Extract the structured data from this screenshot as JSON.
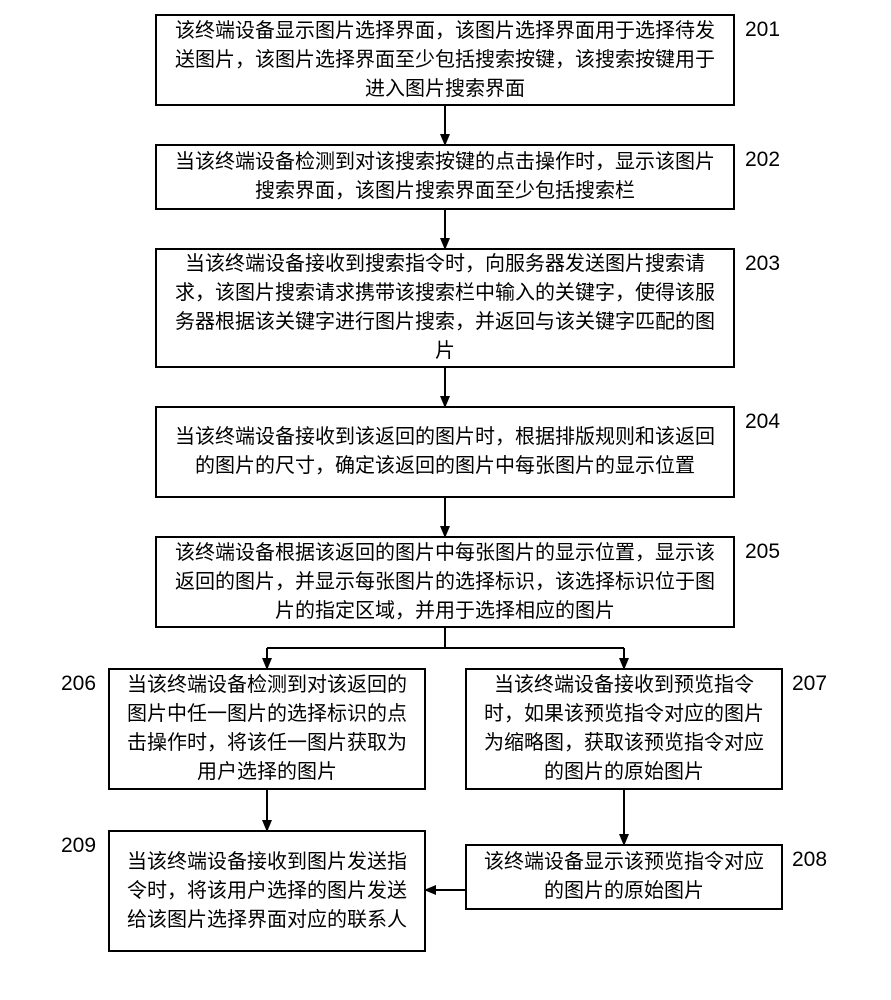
{
  "chart_data": {
    "type": "flowchart",
    "nodes": [
      {
        "id": "201",
        "text": "该终端设备显示图片选择界面，该图片选择界面用于选择待发送图片，该图片选择界面至少包括搜索按键，该搜索按键用于进入图片搜索界面"
      },
      {
        "id": "202",
        "text": "当该终端设备检测到对该搜索按键的点击操作时，显示该图片搜索界面，该图片搜索界面至少包括搜索栏"
      },
      {
        "id": "203",
        "text": "当该终端设备接收到搜索指令时，向服务器发送图片搜索请求，该图片搜索请求携带该搜索栏中输入的关键字，使得该服务器根据该关键字进行图片搜索，并返回与该关键字匹配的图片"
      },
      {
        "id": "204",
        "text": "当该终端设备接收到该返回的图片时，根据排版规则和该返回的图片的尺寸，确定该返回的图片中每张图片的显示位置"
      },
      {
        "id": "205",
        "text": "该终端设备根据该返回的图片中每张图片的显示位置，显示该返回的图片，并显示每张图片的选择标识，该选择标识位于图片的指定区域，并用于选择相应的图片"
      },
      {
        "id": "206",
        "text": "当该终端设备检测到对该返回的图片中任一图片的选择标识的点击操作时，将该任一图片获取为用户选择的图片"
      },
      {
        "id": "207",
        "text": "当该终端设备接收到预览指令时，如果该预览指令对应的图片为缩略图，获取该预览指令对应的图片的原始图片"
      },
      {
        "id": "208",
        "text": "该终端设备显示该预览指令对应的图片的原始图片"
      },
      {
        "id": "209",
        "text": "当该终端设备接收到图片发送指令时，将该用户选择的图片发送给该图片选择界面对应的联系人"
      }
    ],
    "edges": [
      {
        "from": "201",
        "to": "202"
      },
      {
        "from": "202",
        "to": "203"
      },
      {
        "from": "203",
        "to": "204"
      },
      {
        "from": "204",
        "to": "205"
      },
      {
        "from": "205",
        "to": "206"
      },
      {
        "from": "205",
        "to": "207"
      },
      {
        "from": "206",
        "to": "209"
      },
      {
        "from": "207",
        "to": "208"
      },
      {
        "from": "208",
        "to": "209"
      }
    ]
  },
  "labels": {
    "201": "201",
    "202": "202",
    "203": "203",
    "204": "204",
    "205": "205",
    "206": "206",
    "207": "207",
    "208": "208",
    "209": "209"
  }
}
